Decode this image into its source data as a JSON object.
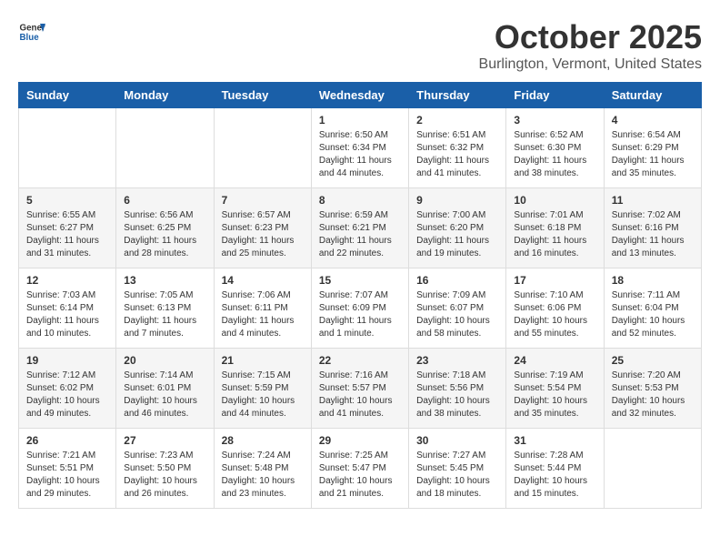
{
  "header": {
    "logo_general": "General",
    "logo_blue": "Blue",
    "month": "October 2025",
    "location": "Burlington, Vermont, United States"
  },
  "weekdays": [
    "Sunday",
    "Monday",
    "Tuesday",
    "Wednesday",
    "Thursday",
    "Friday",
    "Saturday"
  ],
  "weeks": [
    [
      {
        "day": "",
        "info": ""
      },
      {
        "day": "",
        "info": ""
      },
      {
        "day": "",
        "info": ""
      },
      {
        "day": "1",
        "info": "Sunrise: 6:50 AM\nSunset: 6:34 PM\nDaylight: 11 hours\nand 44 minutes."
      },
      {
        "day": "2",
        "info": "Sunrise: 6:51 AM\nSunset: 6:32 PM\nDaylight: 11 hours\nand 41 minutes."
      },
      {
        "day": "3",
        "info": "Sunrise: 6:52 AM\nSunset: 6:30 PM\nDaylight: 11 hours\nand 38 minutes."
      },
      {
        "day": "4",
        "info": "Sunrise: 6:54 AM\nSunset: 6:29 PM\nDaylight: 11 hours\nand 35 minutes."
      }
    ],
    [
      {
        "day": "5",
        "info": "Sunrise: 6:55 AM\nSunset: 6:27 PM\nDaylight: 11 hours\nand 31 minutes."
      },
      {
        "day": "6",
        "info": "Sunrise: 6:56 AM\nSunset: 6:25 PM\nDaylight: 11 hours\nand 28 minutes."
      },
      {
        "day": "7",
        "info": "Sunrise: 6:57 AM\nSunset: 6:23 PM\nDaylight: 11 hours\nand 25 minutes."
      },
      {
        "day": "8",
        "info": "Sunrise: 6:59 AM\nSunset: 6:21 PM\nDaylight: 11 hours\nand 22 minutes."
      },
      {
        "day": "9",
        "info": "Sunrise: 7:00 AM\nSunset: 6:20 PM\nDaylight: 11 hours\nand 19 minutes."
      },
      {
        "day": "10",
        "info": "Sunrise: 7:01 AM\nSunset: 6:18 PM\nDaylight: 11 hours\nand 16 minutes."
      },
      {
        "day": "11",
        "info": "Sunrise: 7:02 AM\nSunset: 6:16 PM\nDaylight: 11 hours\nand 13 minutes."
      }
    ],
    [
      {
        "day": "12",
        "info": "Sunrise: 7:03 AM\nSunset: 6:14 PM\nDaylight: 11 hours\nand 10 minutes."
      },
      {
        "day": "13",
        "info": "Sunrise: 7:05 AM\nSunset: 6:13 PM\nDaylight: 11 hours\nand 7 minutes."
      },
      {
        "day": "14",
        "info": "Sunrise: 7:06 AM\nSunset: 6:11 PM\nDaylight: 11 hours\nand 4 minutes."
      },
      {
        "day": "15",
        "info": "Sunrise: 7:07 AM\nSunset: 6:09 PM\nDaylight: 11 hours\nand 1 minute."
      },
      {
        "day": "16",
        "info": "Sunrise: 7:09 AM\nSunset: 6:07 PM\nDaylight: 10 hours\nand 58 minutes."
      },
      {
        "day": "17",
        "info": "Sunrise: 7:10 AM\nSunset: 6:06 PM\nDaylight: 10 hours\nand 55 minutes."
      },
      {
        "day": "18",
        "info": "Sunrise: 7:11 AM\nSunset: 6:04 PM\nDaylight: 10 hours\nand 52 minutes."
      }
    ],
    [
      {
        "day": "19",
        "info": "Sunrise: 7:12 AM\nSunset: 6:02 PM\nDaylight: 10 hours\nand 49 minutes."
      },
      {
        "day": "20",
        "info": "Sunrise: 7:14 AM\nSunset: 6:01 PM\nDaylight: 10 hours\nand 46 minutes."
      },
      {
        "day": "21",
        "info": "Sunrise: 7:15 AM\nSunset: 5:59 PM\nDaylight: 10 hours\nand 44 minutes."
      },
      {
        "day": "22",
        "info": "Sunrise: 7:16 AM\nSunset: 5:57 PM\nDaylight: 10 hours\nand 41 minutes."
      },
      {
        "day": "23",
        "info": "Sunrise: 7:18 AM\nSunset: 5:56 PM\nDaylight: 10 hours\nand 38 minutes."
      },
      {
        "day": "24",
        "info": "Sunrise: 7:19 AM\nSunset: 5:54 PM\nDaylight: 10 hours\nand 35 minutes."
      },
      {
        "day": "25",
        "info": "Sunrise: 7:20 AM\nSunset: 5:53 PM\nDaylight: 10 hours\nand 32 minutes."
      }
    ],
    [
      {
        "day": "26",
        "info": "Sunrise: 7:21 AM\nSunset: 5:51 PM\nDaylight: 10 hours\nand 29 minutes."
      },
      {
        "day": "27",
        "info": "Sunrise: 7:23 AM\nSunset: 5:50 PM\nDaylight: 10 hours\nand 26 minutes."
      },
      {
        "day": "28",
        "info": "Sunrise: 7:24 AM\nSunset: 5:48 PM\nDaylight: 10 hours\nand 23 minutes."
      },
      {
        "day": "29",
        "info": "Sunrise: 7:25 AM\nSunset: 5:47 PM\nDaylight: 10 hours\nand 21 minutes."
      },
      {
        "day": "30",
        "info": "Sunrise: 7:27 AM\nSunset: 5:45 PM\nDaylight: 10 hours\nand 18 minutes."
      },
      {
        "day": "31",
        "info": "Sunrise: 7:28 AM\nSunset: 5:44 PM\nDaylight: 10 hours\nand 15 minutes."
      },
      {
        "day": "",
        "info": ""
      }
    ]
  ]
}
